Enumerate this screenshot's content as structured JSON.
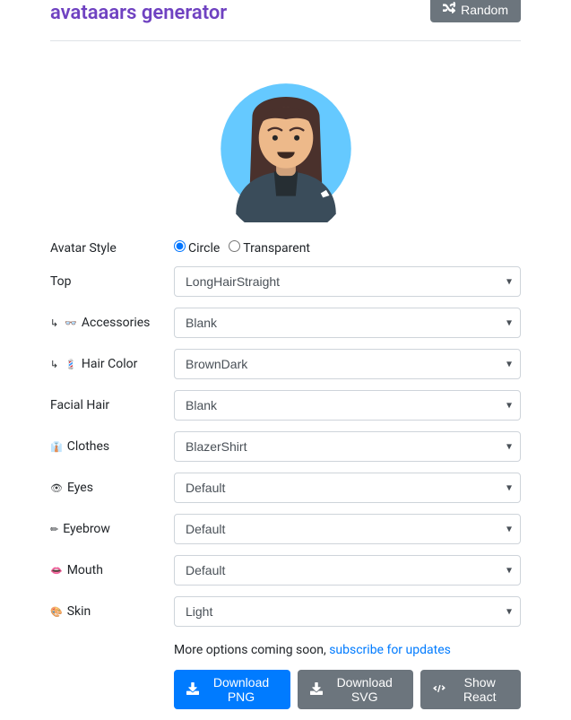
{
  "header": {
    "title": "avataaars generator",
    "random_btn": "Random"
  },
  "style_row": {
    "label": "Avatar Style",
    "circle": "Circle",
    "transparent": "Transparent"
  },
  "fields": {
    "top": {
      "label": "Top",
      "value": "LongHairStraight",
      "icon": "",
      "indent": false
    },
    "accessories": {
      "label": "Accessories",
      "value": "Blank",
      "icon": "👓",
      "indent": true
    },
    "hairColor": {
      "label": "Hair Color",
      "value": "BrownDark",
      "icon": "💈",
      "indent": true
    },
    "facialHair": {
      "label": "Facial Hair",
      "value": "Blank",
      "icon": "",
      "indent": false
    },
    "clothes": {
      "label": "Clothes",
      "value": "BlazerShirt",
      "icon": "👔",
      "indent": false
    },
    "eyes": {
      "label": "Eyes",
      "value": "Default",
      "icon": "👁",
      "indent": false
    },
    "eyebrow": {
      "label": "Eyebrow",
      "value": "Default",
      "icon": "✏",
      "indent": false
    },
    "mouth": {
      "label": "Mouth",
      "value": "Default",
      "icon": "👄",
      "indent": false
    },
    "skin": {
      "label": "Skin",
      "value": "Light",
      "icon": "🎨",
      "indent": false
    }
  },
  "footer": {
    "more_text": "More options coming soon, ",
    "subscribe": "subscribe for updates",
    "download_png": "Download PNG",
    "download_svg": "Download SVG",
    "show_react": "Show React"
  }
}
